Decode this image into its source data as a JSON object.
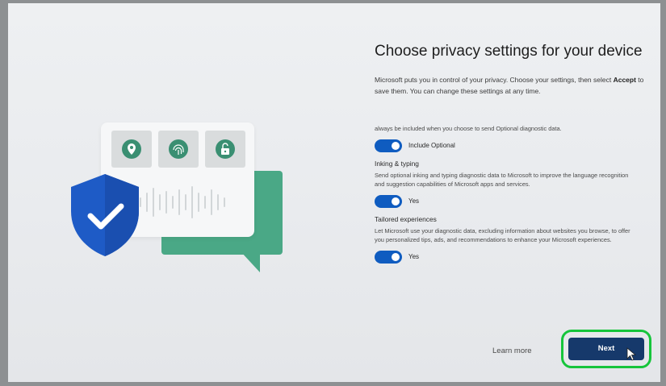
{
  "title": "Choose privacy settings for your device",
  "description": {
    "part1": "Microsoft puts you in control of your privacy. Choose your settings, then select ",
    "accept": "Accept",
    "part2": " to save them. You can change these settings at any time."
  },
  "settings": {
    "cutoff_text": "always be included when you choose to send Optional diagnostic data.",
    "diagnostic_toggle_label": "Include Optional",
    "inking_heading": "Inking & typing",
    "inking_desc": "Send optional inking and typing diagnostic data to Microsoft to improve the language recognition and suggestion capabilities of Microsoft apps and services.",
    "inking_toggle_label": "Yes",
    "tailored_heading": "Tailored experiences",
    "tailored_desc": "Let Microsoft use your diagnostic data, excluding information about websites you browse, to offer you personalized tips, ads, and recommendations to enhance your Microsoft experiences.",
    "tailored_toggle_label": "Yes"
  },
  "footer": {
    "learn_more": "Learn more",
    "next": "Next"
  },
  "colors": {
    "toggle_on": "#0f5cc0",
    "next_button": "#16396b",
    "highlight": "#16c53b",
    "illustration_green": "#4aa886",
    "shield_blue": "#1e5bc6"
  },
  "toggles": {
    "diagnostic_on": true,
    "inking_on": true,
    "tailored_on": true
  },
  "icons": [
    "location-pin-icon",
    "fingerprint-icon",
    "unlock-icon",
    "shield-check-icon",
    "cursor-icon"
  ]
}
